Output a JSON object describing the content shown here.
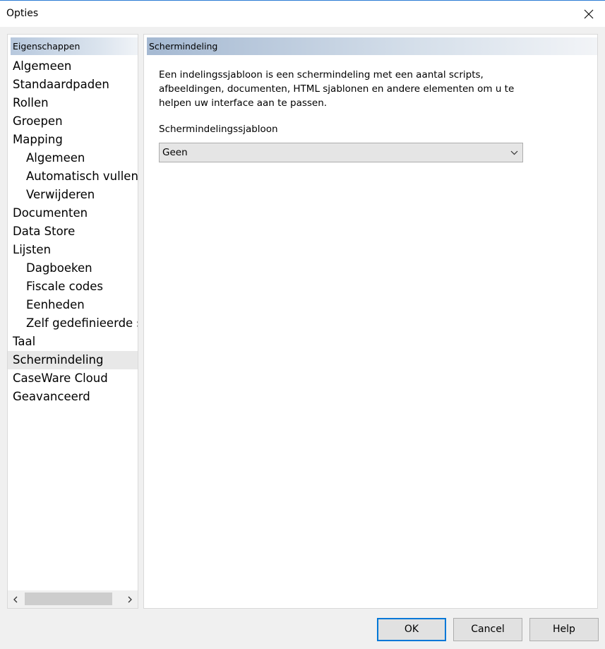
{
  "window": {
    "title": "Opties"
  },
  "left_panel": {
    "header": "Eigenschappen",
    "items": [
      {
        "label": "Algemeen",
        "level": 0
      },
      {
        "label": "Standaardpaden",
        "level": 0
      },
      {
        "label": "Rollen",
        "level": 0
      },
      {
        "label": "Groepen",
        "level": 0
      },
      {
        "label": "Mapping",
        "level": 0
      },
      {
        "label": "Algemeen",
        "level": 1
      },
      {
        "label": "Automatisch vullen",
        "level": 1
      },
      {
        "label": "Verwijderen",
        "level": 1
      },
      {
        "label": "Documenten",
        "level": 0
      },
      {
        "label": "Data Store",
        "level": 0
      },
      {
        "label": "Lijsten",
        "level": 0
      },
      {
        "label": "Dagboeken",
        "level": 1
      },
      {
        "label": "Fiscale codes",
        "level": 1
      },
      {
        "label": "Eenheden",
        "level": 1
      },
      {
        "label": "Zelf gedefinieerde sa",
        "level": 1
      },
      {
        "label": "Taal",
        "level": 0
      },
      {
        "label": "Schermindeling",
        "level": 0,
        "selected": true
      },
      {
        "label": "CaseWare Cloud",
        "level": 0
      },
      {
        "label": "Geavanceerd",
        "level": 0
      }
    ]
  },
  "right_panel": {
    "header": "Schermindeling",
    "description": "Een indelingssjabloon is een schermindeling met een aantal scripts, afbeeldingen, documenten, HTML sjablonen en andere elementen om u te helpen uw interface aan te passen.",
    "field_label": "Schermindelingssjabloon",
    "select_value": "Geen"
  },
  "buttons": {
    "ok": "OK",
    "cancel": "Cancel",
    "help": "Help"
  },
  "colors": {
    "accent": "#0078d7",
    "selected_item": "#e8e8e8"
  }
}
